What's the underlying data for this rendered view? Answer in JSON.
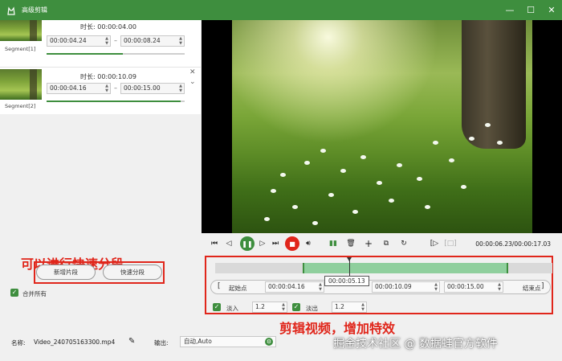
{
  "window": {
    "title": "高级剪辑"
  },
  "segments": [
    {
      "label": "Segment[1]",
      "duration_label": "时长:",
      "duration": "00:00:04.00",
      "start": "00:00:04.24",
      "end": "00:00:08.24",
      "dash": "–",
      "progress": 0.55
    },
    {
      "label": "Segment[2]",
      "duration_label": "时长:",
      "duration": "00:00:10.09",
      "start": "00:00:04.16",
      "end": "00:00:15.00",
      "dash": "–",
      "progress": 0.97
    }
  ],
  "left_actions": {
    "new_clip": "新增片段",
    "quick_split": "快速分段",
    "merge_all": "合并所有"
  },
  "annotations": {
    "left": "可以进行快速分段",
    "right": "剪辑视频，增加特效"
  },
  "player": {
    "timecode": "00:00:06.23/00:00:17.03"
  },
  "timeline": {
    "selection_start": 0.26,
    "selection_end": 0.87,
    "playhead": 0.397,
    "tooltip": "00:00:05.13"
  },
  "trim": {
    "start_label": "起始点",
    "start_value": "00:00:04.16",
    "mid_value": "00:00:10.09",
    "end_value": "00:00:15.00",
    "end_label": "结束点",
    "left_bracket": "[",
    "right_bracket": "]"
  },
  "effects": {
    "fade_in_label": "淡入",
    "fade_in_value": "1.2",
    "fade_out_label": "淡出",
    "fade_out_value": "1.2"
  },
  "bottom": {
    "name_label": "名称:",
    "name_value": "Video_240705163300.mp4",
    "output_label": "输出:",
    "output_value": "自动,Auto"
  },
  "watermark": "掘金技术社区 @ 数据蛙官方软件",
  "colors": {
    "brand_green": "#3e8e3e",
    "annotation_red": "#e0261b",
    "stop_red": "#e0261b"
  }
}
